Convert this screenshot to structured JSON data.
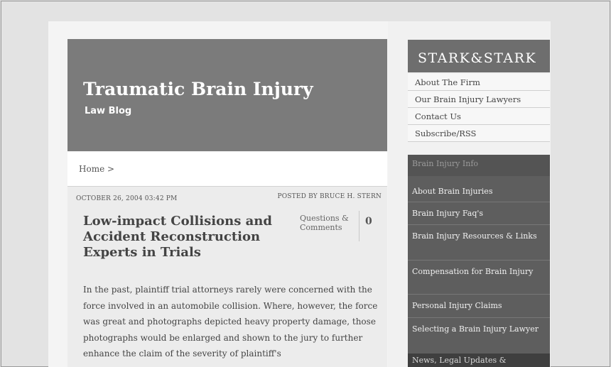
{
  "blog": {
    "title": "Traumatic Brain Injury",
    "subtitle": "Law Blog"
  },
  "breadcrumb": {
    "home": "Home >"
  },
  "post": {
    "date": "OCTOBER 26, 2004 03:42 PM",
    "author": "POSTED BY BRUCE H. STERN",
    "title": "Low-impact Collisions and Accident Reconstruction Experts in Trials",
    "comments_label": "Questions & Comments",
    "comments_count": "0",
    "body": "In the past, plaintiff trial attorneys rarely were concerned with the force involved in an automobile collision. Where, however, the force was great and photographs depicted heavy property damage, those photographs would be enlarged and shown to the jury to further enhance the claim of the severity of plaintiff's"
  },
  "sidebar": {
    "logo": "STARK&STARK",
    "links": [
      "About The Firm",
      "Our Brain Injury Lawyers",
      "Contact Us",
      "Subscribe/RSS"
    ],
    "panel_title": "Brain Injury Info",
    "nav_items": [
      "About Brain Injuries",
      "Brain Injury Faq's",
      "Brain Injury Resources & Links",
      "Compensation for Brain Injury",
      "Personal Injury Claims",
      "Selecting a Brain Injury Lawyer"
    ],
    "news": "News, Legal Updates &"
  }
}
